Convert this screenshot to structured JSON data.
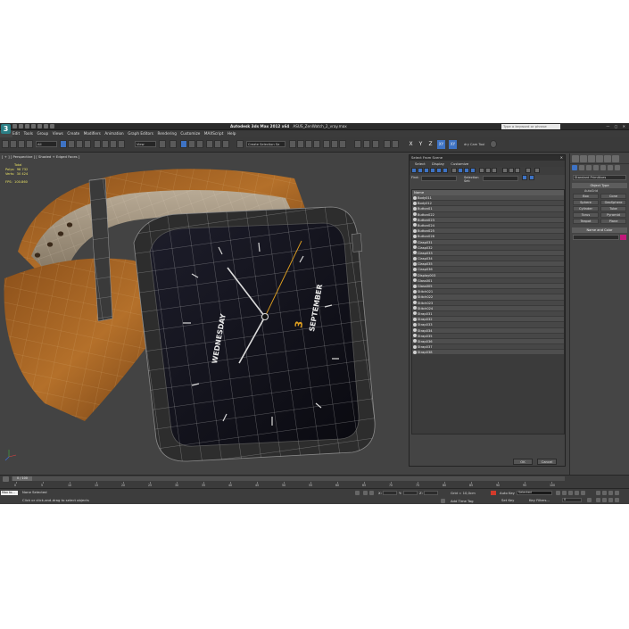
{
  "app": {
    "title_bold": "Autodesk 3ds Max  2012 x64",
    "title_file": "ASUS_ZenWatch_2_vray.max",
    "search_placeholder": "Type a keyword or phrase",
    "logo_letter": "3"
  },
  "menu": [
    "Edit",
    "Tools",
    "Group",
    "Views",
    "Create",
    "Modifiers",
    "Animation",
    "Graph Editors",
    "Rendering",
    "Customize",
    "MAXScript",
    "Help"
  ],
  "toolbar": {
    "filter_value": "All",
    "ref_coord": "View",
    "named_selection": "Create Selection Se",
    "axis_x": "X",
    "axis_y": "Y",
    "axis_z": "Z",
    "axis_xy": "XY",
    "axis_xy2": "XY",
    "cam_tool": "dry Cam Tool"
  },
  "viewport": {
    "label": "[ + ] [ Perspective ] [ Shaded + Edged Faces ]",
    "stats_total": "Total",
    "stats_polys_label": "Polys:",
    "stats_polys": "98 732",
    "stats_verts_label": "Verts:",
    "stats_verts": "30 424",
    "fps_label": "FPS:",
    "fps": "100.860",
    "watch_day": "WEDNESDAY",
    "watch_month": "SEPTEMBER",
    "watch_date": "3",
    "colors": {
      "strap": "#b06a25",
      "strap_dark": "#6e3e14",
      "face": "#111118",
      "bezel": "#2a2a2a",
      "wire": "#c9c9c9",
      "hand_accent": "#e0a020"
    }
  },
  "dialog": {
    "title": "Select From Scene",
    "close": "✕",
    "menu": [
      "Select",
      "Display",
      "Customize"
    ],
    "find_label": "Find:",
    "selection_set_label": "Selection Set:",
    "column_name": "Name",
    "ok": "OK",
    "cancel": "Cancel",
    "objects": [
      "Body011",
      "Body012",
      "Button01",
      "Button022",
      "Button023",
      "Button024",
      "Button025",
      "Button026",
      "Clasp031",
      "Clasp032",
      "Clasp033",
      "Clasp034",
      "Clasp035",
      "Clasp036",
      "Display003",
      "Glass001",
      "Glass005",
      "Stitch021",
      "Stitch022",
      "Stitch023",
      "Stitch024",
      "Strap031",
      "Strap032",
      "Strap033",
      "Strap034",
      "Strap035",
      "Strap036",
      "Strap037",
      "Strap038"
    ]
  },
  "command_panel": {
    "category": "Standard Primitives",
    "object_type": "Object Type",
    "autogrid": "AutoGrid",
    "primitives": [
      "Box",
      "Cone",
      "Sphere",
      "GeoSphere",
      "Cylinder",
      "Tube",
      "Torus",
      "Pyramid",
      "Teapot",
      "Plane"
    ],
    "name_and_color": "Name and Color",
    "swatch_color": "#c2187a"
  },
  "timeline": {
    "frame_display": "0 / 100",
    "ticks": [
      "0",
      "5",
      "10",
      "15",
      "20",
      "25",
      "30",
      "35",
      "40",
      "45",
      "50",
      "55",
      "60",
      "65",
      "70",
      "75",
      "80",
      "85",
      "90",
      "95",
      "100"
    ]
  },
  "status": {
    "maxscript": "Max to...",
    "selection_status": "None Selected",
    "prompt": "Click or click-and-drag to select objects",
    "x_label": "X:",
    "y_label": "Y:",
    "z_label": "Z:",
    "grid": "Grid = 10,0cm",
    "auto_key": "Auto Key",
    "set_key": "Set Key",
    "selected_option": "Selected",
    "key_filters": "Key Filters...",
    "add_time_tag": "Add Time Tag",
    "frame_value": "0"
  }
}
